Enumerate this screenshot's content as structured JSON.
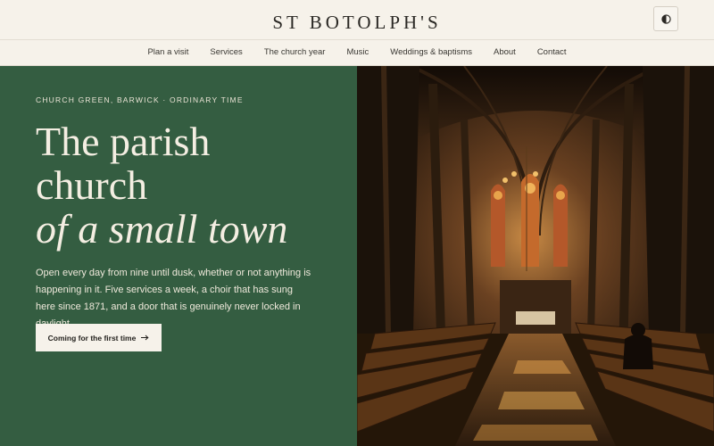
{
  "site": {
    "name": "ST BOTOLPH'S"
  },
  "theme_toggle": {
    "icon": "contrast-icon"
  },
  "nav": {
    "items": [
      {
        "label": "Plan a visit"
      },
      {
        "label": "Services"
      },
      {
        "label": "The church year"
      },
      {
        "label": "Music"
      },
      {
        "label": "Weddings & baptisms"
      },
      {
        "label": "About"
      },
      {
        "label": "Contact"
      }
    ]
  },
  "hero": {
    "eyebrow": "CHURCH GREEN, BARWICK · ORDINARY TIME",
    "headline_line1": "The parish",
    "headline_line2": "church",
    "headline_line3": "of a small town",
    "lede": "Open every day from nine until dusk, whether or not anything is happening in it. Five services a week, a choir that has sung here since 1871, and a door that is genuinely never locked in daylight.",
    "cta_label": "Coming for the first time",
    "cta_icon": "arrow-right-icon",
    "image": "church-interior-photo"
  },
  "colors": {
    "hero_green": "#345d41",
    "cream": "#f6f2ea",
    "ink": "#2a2824"
  }
}
